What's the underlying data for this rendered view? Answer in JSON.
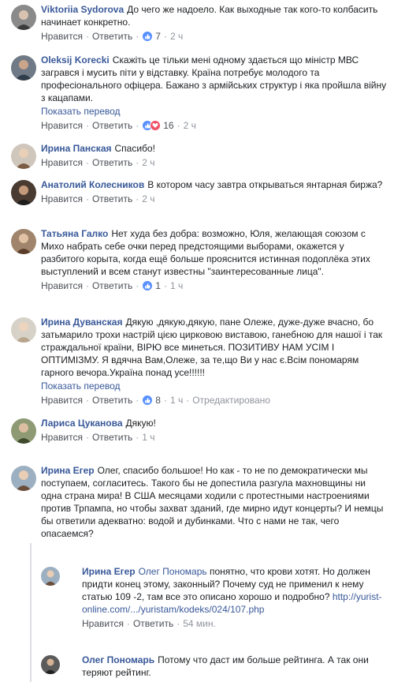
{
  "labels": {
    "like": "Нравится",
    "reply": "Ответить",
    "see_translation": "Показать перевод",
    "edited": "Отредактировано"
  },
  "comments": [
    {
      "author": "Viktoriia Sydorova",
      "text": "До чего же надоело. Как выходные так кого-то колбасить начинает конкретно.",
      "reactions": "7",
      "time": "2 ч"
    },
    {
      "author": "Oleksij Korecki",
      "text": "Скажіть це тільки мені одному здається що міністр МВС загрався і мусить піти у відставку. Країна потребує молодого та професіонального офіцера. Бажано з армійських структур і яка пройшла війну з кацапами.",
      "reactions": "16",
      "time": "2 ч"
    },
    {
      "author": "Ирина Панская",
      "text": "Спасибо!",
      "time": "2 ч"
    },
    {
      "author": "Анатолий Колесников",
      "text": "В котором часу завтра открываться янтарная биржа?",
      "time": "2 ч"
    },
    {
      "author": "Татьяна Галко",
      "text": "Нет худа без добра: возможно, Юля, желающая союзом с Михо набрать себе очки перед предстоящими выборами, окажется у разбитого корыта, когда ещё больше прояснится истинная подоплёка этих выступлений и всем станут известны \"заинтересованные лица\".",
      "reactions": "1",
      "time": "1 ч"
    },
    {
      "author": "Ирина Дуванская",
      "text": "Дякую ,дякую,дякую, пане Олеже, дуже-дуже вчасно, бо затьмарило трохи настрій цією цирковою виставою, ганебною для нашої і так страждальної країни, ВІРЮ все минеться. ПОЗИТИВУ НАМ УСІМ І ОПТИМІЗМУ. Я вдячна Вам,Олеже, за те,що Ви у нас є.Всім пономарям гарного вечора.Україна понад усе!!!!!!",
      "reactions": "8",
      "time": "1 ч"
    },
    {
      "author": "Лариса Цуканова",
      "text": "Дякую!",
      "time": "1 ч"
    },
    {
      "author": "Ирина Егер",
      "text": "Олег, спасибо большое! Но как - то не по демократически мы поступаем, согласитесь. Такого бы не допестила разгула махновщины ни одна страна мира! В США месяцами ходили с протестными настроениями против Трпампа, но чтобы захват зданий, где мирно идут концерты? И немцы бы ответили адекватно: водой и дубинками. Что с нами не так, чего опасаемся?"
    },
    {
      "author": "Ирина Егер",
      "mention": "Олег Пономарь",
      "text": "понятно, что крови хотят. Но должен придти конец этому, законный? Почему суд не применил к нему статью 109 -2, там все это описано хорошо и подробно?",
      "link": "http://yurist-online.com/.../yuristam/kodeks/024/107.php",
      "time": "54 мин."
    },
    {
      "author": "Олег Пономарь",
      "text": "Потому что даст им больше рейтинга. А так они теряют рейтинг."
    }
  ]
}
